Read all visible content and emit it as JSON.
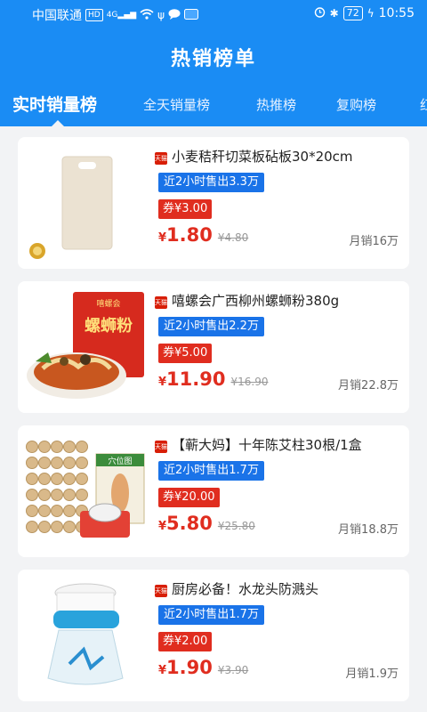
{
  "status_bar": {
    "carrier": "中国联通",
    "hd": "HD",
    "net": "4G",
    "battery": "72",
    "time": "10:55"
  },
  "header": {
    "title": "热销榜单"
  },
  "tabs": [
    {
      "label": "实时销量榜",
      "active": true
    },
    {
      "label": "全天销量榜",
      "active": false
    },
    {
      "label": "热推榜",
      "active": false
    },
    {
      "label": "复购榜",
      "active": false
    },
    {
      "label": "红",
      "active": false
    }
  ],
  "badge_text": "天猫",
  "products": [
    {
      "title": "小麦秸秆切菜板砧板30*20cm",
      "sold": "近2小时售出3.3万",
      "coupon": "券¥3.00",
      "yen": "¥",
      "price": "1.80",
      "original": "¥4.80",
      "monthly": "月销16万"
    },
    {
      "title": "嘻螺会广西柳州螺蛳粉380g",
      "sold": "近2小时售出2.2万",
      "coupon": "券¥5.00",
      "yen": "¥",
      "price": "11.90",
      "original": "¥16.90",
      "monthly": "月销22.8万",
      "package_label": "螺蛳粉",
      "brand": "嘻螺会"
    },
    {
      "title": "【蕲大妈】十年陈艾柱30根/1盒",
      "sold": "近2小时售出1.7万",
      "coupon": "券¥20.00",
      "yen": "¥",
      "price": "5.80",
      "original": "¥25.80",
      "monthly": "月销18.8万",
      "box_label": "穴位图"
    },
    {
      "title": "厨房必备！水龙头防溅头",
      "sold": "近2小时售出1.7万",
      "coupon": "券¥2.00",
      "yen": "¥",
      "price": "1.90",
      "original": "¥3.90",
      "monthly": "月销1.9万"
    }
  ],
  "colors": {
    "header_blue": "#1a8cf4",
    "sold_blue": "#1a73e8",
    "price_red": "#e02d1f"
  }
}
